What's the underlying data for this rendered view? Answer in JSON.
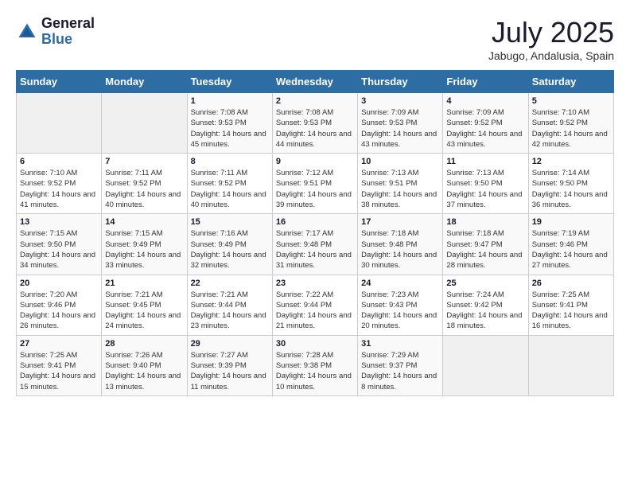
{
  "header": {
    "logo_general": "General",
    "logo_blue": "Blue",
    "month_year": "July 2025",
    "location": "Jabugo, Andalusia, Spain"
  },
  "weekdays": [
    "Sunday",
    "Monday",
    "Tuesday",
    "Wednesday",
    "Thursday",
    "Friday",
    "Saturday"
  ],
  "weeks": [
    [
      {
        "day": "",
        "info": ""
      },
      {
        "day": "",
        "info": ""
      },
      {
        "day": "1",
        "info": "Sunrise: 7:08 AM\nSunset: 9:53 PM\nDaylight: 14 hours and 45 minutes."
      },
      {
        "day": "2",
        "info": "Sunrise: 7:08 AM\nSunset: 9:53 PM\nDaylight: 14 hours and 44 minutes."
      },
      {
        "day": "3",
        "info": "Sunrise: 7:09 AM\nSunset: 9:53 PM\nDaylight: 14 hours and 43 minutes."
      },
      {
        "day": "4",
        "info": "Sunrise: 7:09 AM\nSunset: 9:52 PM\nDaylight: 14 hours and 43 minutes."
      },
      {
        "day": "5",
        "info": "Sunrise: 7:10 AM\nSunset: 9:52 PM\nDaylight: 14 hours and 42 minutes."
      }
    ],
    [
      {
        "day": "6",
        "info": "Sunrise: 7:10 AM\nSunset: 9:52 PM\nDaylight: 14 hours and 41 minutes."
      },
      {
        "day": "7",
        "info": "Sunrise: 7:11 AM\nSunset: 9:52 PM\nDaylight: 14 hours and 40 minutes."
      },
      {
        "day": "8",
        "info": "Sunrise: 7:11 AM\nSunset: 9:52 PM\nDaylight: 14 hours and 40 minutes."
      },
      {
        "day": "9",
        "info": "Sunrise: 7:12 AM\nSunset: 9:51 PM\nDaylight: 14 hours and 39 minutes."
      },
      {
        "day": "10",
        "info": "Sunrise: 7:13 AM\nSunset: 9:51 PM\nDaylight: 14 hours and 38 minutes."
      },
      {
        "day": "11",
        "info": "Sunrise: 7:13 AM\nSunset: 9:50 PM\nDaylight: 14 hours and 37 minutes."
      },
      {
        "day": "12",
        "info": "Sunrise: 7:14 AM\nSunset: 9:50 PM\nDaylight: 14 hours and 36 minutes."
      }
    ],
    [
      {
        "day": "13",
        "info": "Sunrise: 7:15 AM\nSunset: 9:50 PM\nDaylight: 14 hours and 34 minutes."
      },
      {
        "day": "14",
        "info": "Sunrise: 7:15 AM\nSunset: 9:49 PM\nDaylight: 14 hours and 33 minutes."
      },
      {
        "day": "15",
        "info": "Sunrise: 7:16 AM\nSunset: 9:49 PM\nDaylight: 14 hours and 32 minutes."
      },
      {
        "day": "16",
        "info": "Sunrise: 7:17 AM\nSunset: 9:48 PM\nDaylight: 14 hours and 31 minutes."
      },
      {
        "day": "17",
        "info": "Sunrise: 7:18 AM\nSunset: 9:48 PM\nDaylight: 14 hours and 30 minutes."
      },
      {
        "day": "18",
        "info": "Sunrise: 7:18 AM\nSunset: 9:47 PM\nDaylight: 14 hours and 28 minutes."
      },
      {
        "day": "19",
        "info": "Sunrise: 7:19 AM\nSunset: 9:46 PM\nDaylight: 14 hours and 27 minutes."
      }
    ],
    [
      {
        "day": "20",
        "info": "Sunrise: 7:20 AM\nSunset: 9:46 PM\nDaylight: 14 hours and 26 minutes."
      },
      {
        "day": "21",
        "info": "Sunrise: 7:21 AM\nSunset: 9:45 PM\nDaylight: 14 hours and 24 minutes."
      },
      {
        "day": "22",
        "info": "Sunrise: 7:21 AM\nSunset: 9:44 PM\nDaylight: 14 hours and 23 minutes."
      },
      {
        "day": "23",
        "info": "Sunrise: 7:22 AM\nSunset: 9:44 PM\nDaylight: 14 hours and 21 minutes."
      },
      {
        "day": "24",
        "info": "Sunrise: 7:23 AM\nSunset: 9:43 PM\nDaylight: 14 hours and 20 minutes."
      },
      {
        "day": "25",
        "info": "Sunrise: 7:24 AM\nSunset: 9:42 PM\nDaylight: 14 hours and 18 minutes."
      },
      {
        "day": "26",
        "info": "Sunrise: 7:25 AM\nSunset: 9:41 PM\nDaylight: 14 hours and 16 minutes."
      }
    ],
    [
      {
        "day": "27",
        "info": "Sunrise: 7:25 AM\nSunset: 9:41 PM\nDaylight: 14 hours and 15 minutes."
      },
      {
        "day": "28",
        "info": "Sunrise: 7:26 AM\nSunset: 9:40 PM\nDaylight: 14 hours and 13 minutes."
      },
      {
        "day": "29",
        "info": "Sunrise: 7:27 AM\nSunset: 9:39 PM\nDaylight: 14 hours and 11 minutes."
      },
      {
        "day": "30",
        "info": "Sunrise: 7:28 AM\nSunset: 9:38 PM\nDaylight: 14 hours and 10 minutes."
      },
      {
        "day": "31",
        "info": "Sunrise: 7:29 AM\nSunset: 9:37 PM\nDaylight: 14 hours and 8 minutes."
      },
      {
        "day": "",
        "info": ""
      },
      {
        "day": "",
        "info": ""
      }
    ]
  ]
}
